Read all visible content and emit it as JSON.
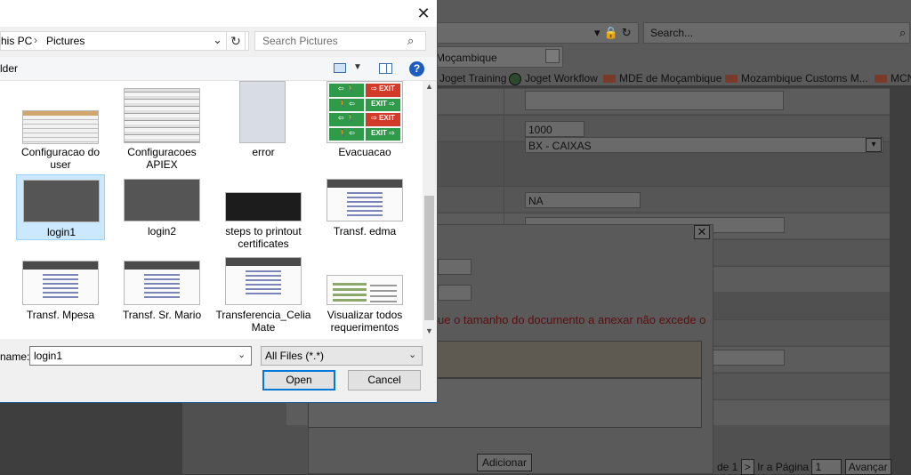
{
  "browser": {
    "search_placeholder": "Search...",
    "tab_title": "Moçambique",
    "favorites": [
      "Joget Training",
      "Joget Workflow",
      "MDE de Moçambique",
      "Mozambique Customs M...",
      "MCN"
    ]
  },
  "background_form": {
    "quantity_value": "1000",
    "package_select_value": "BX - CAIXAS",
    "na_value": "NA",
    "warning_text": "ue o tamanho do documento a anexar não excede o",
    "add_button": "Adicionar",
    "pager_of": "de 1",
    "pager_next": ">",
    "goto_label": "Ir a Página",
    "goto_value": "1",
    "advance_button": "Avançar",
    "close_glyph": "✕"
  },
  "file_dialog": {
    "close_glyph": "✕",
    "breadcrumb": [
      "his PC",
      "Pictures"
    ],
    "search_placeholder": "Search Pictures",
    "command_folder_label": "lder",
    "files": [
      {
        "label": "Configuracao do user",
        "kind": "form"
      },
      {
        "label": "Configuracoes APIEX",
        "kind": "table"
      },
      {
        "label": "error",
        "kind": "phone"
      },
      {
        "label": "Evacuacao",
        "kind": "signs"
      },
      {
        "label": "login1",
        "kind": "login",
        "selected": true
      },
      {
        "label": "login2",
        "kind": "login"
      },
      {
        "label": "steps to printout certificates",
        "kind": "dark"
      },
      {
        "label": "Transf. edma",
        "kind": "web"
      },
      {
        "label": "Transf. Mpesa",
        "kind": "web"
      },
      {
        "label": "Transf. Sr. Mario",
        "kind": "web"
      },
      {
        "label": "Transferencia_Celia Mate",
        "kind": "web"
      },
      {
        "label": "Visualizar todos requerimentos",
        "kind": "report"
      }
    ],
    "evac_signs": [
      "⇦ 🚶",
      "⇨ EXIT",
      "🚶 ⇦",
      "EXIT ⇨",
      "⇦ 🚶",
      "⇨ EXIT",
      "🚶 ⇦",
      "EXIT ⇨"
    ],
    "file_name_label": "name:",
    "file_name_value": "login1",
    "file_type_value": "All Files (*.*)",
    "open_button": "Open",
    "cancel_button": "Cancel"
  }
}
